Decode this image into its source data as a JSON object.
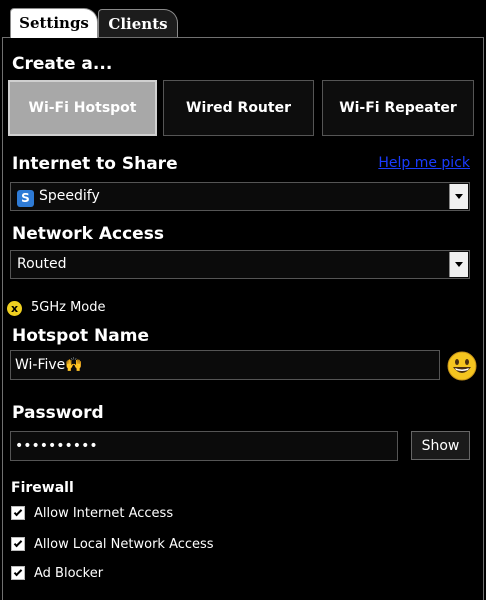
{
  "tabs": [
    {
      "label": "Settings",
      "active": true
    },
    {
      "label": "Clients",
      "active": false
    }
  ],
  "create": {
    "heading": "Create a...",
    "modes": [
      {
        "label": "Wi-Fi Hotspot",
        "selected": true
      },
      {
        "label": "Wired Router",
        "selected": false
      },
      {
        "label": "Wi-Fi Repeater",
        "selected": false
      }
    ]
  },
  "internet": {
    "heading": "Internet to Share",
    "help_link": "Help me pick",
    "selected": "Speedify",
    "badge": "S"
  },
  "network": {
    "heading": "Network Access",
    "selected": "Routed"
  },
  "fiveghz": {
    "label": "5GHz Mode",
    "icon": "x",
    "enabled": false
  },
  "hotspot": {
    "heading": "Hotspot Name",
    "value": "Wi-Five🙌"
  },
  "password": {
    "heading": "Password",
    "value": "••••••••••",
    "show_label": "Show"
  },
  "firewall": {
    "heading": "Firewall",
    "options": [
      {
        "label": "Allow Internet Access",
        "checked": true
      },
      {
        "label": "Allow Local Network Access",
        "checked": true
      },
      {
        "label": "Ad Blocker",
        "checked": true
      }
    ]
  },
  "colors": {
    "selected_mode_bg": "#a8a8a8",
    "link": "#1a3cff",
    "toggle_off": "#f0d020",
    "speedify_blue": "#2e7bd6"
  }
}
